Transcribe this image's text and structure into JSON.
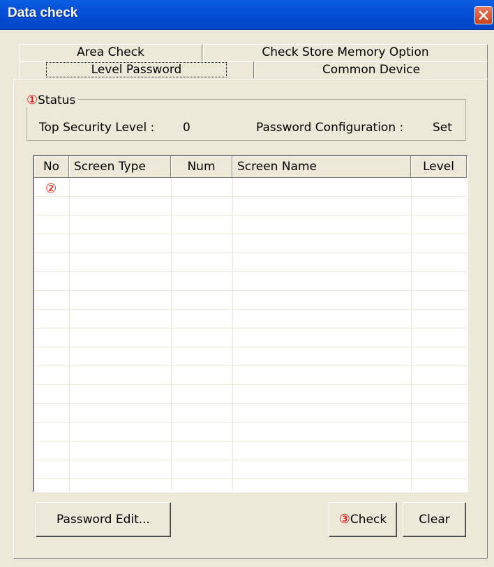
{
  "window": {
    "title": "Data check"
  },
  "tabs": {
    "area_check": "Area Check",
    "check_store_memory": "Check Store Memory Option",
    "level_password": "Level Password",
    "common_device": "Common Device"
  },
  "status": {
    "marker": "①",
    "legend": "Status",
    "top_security_label": "Top Security Level :",
    "top_security_value": "0",
    "password_config_label": "Password Configuration :",
    "password_config_value": "Set"
  },
  "table": {
    "columns": [
      "No",
      "Screen Type",
      "Num",
      "Screen Name",
      "Level"
    ],
    "row_marker": "②",
    "rows": []
  },
  "buttons": {
    "password_edit": "Password Edit...",
    "check_marker": "③",
    "check": "Check",
    "clear": "Clear"
  },
  "colors": {
    "accent": "#0054e3",
    "marker": "#e00000",
    "face": "#ece9d8"
  }
}
